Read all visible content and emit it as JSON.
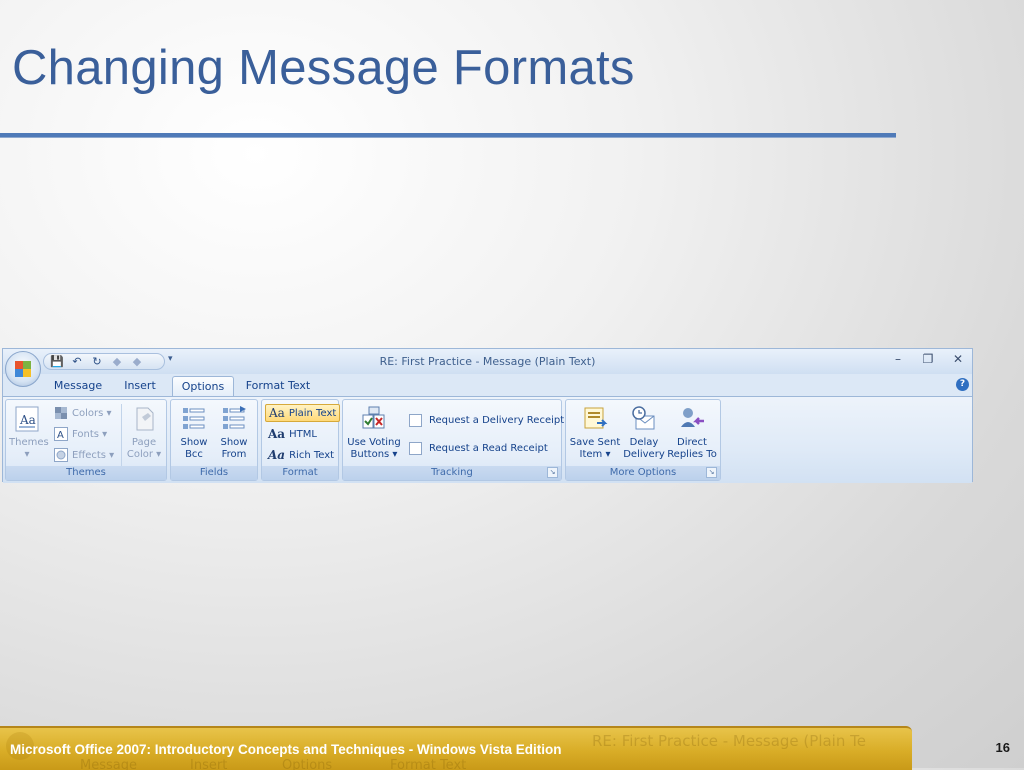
{
  "slide": {
    "title": "Changing Message Formats",
    "footer": "Microsoft Office 2007: Introductory Concepts and Techniques - Windows Vista Edition",
    "page_number": "16",
    "footer_ghost": {
      "message": "Message",
      "insert": "Insert",
      "options": "Options",
      "format_text": "Format Text",
      "title": "RE: First Practice  -  Message (Plain Te"
    }
  },
  "window": {
    "title": "RE: First Practice - Message (Plain Text)",
    "qat": {
      "save": "💾",
      "undo": "↶",
      "redo": "↻",
      "prev": "◆",
      "next": "◆",
      "more": "▾"
    },
    "controls": {
      "minimize": "–",
      "restore": "❐",
      "close": "✕"
    },
    "tabs": [
      {
        "label": "Message",
        "active": false
      },
      {
        "label": "Insert",
        "active": false
      },
      {
        "label": "Options",
        "active": true
      },
      {
        "label": "Format Text",
        "active": false
      }
    ],
    "help": "?"
  },
  "ribbon": {
    "themes": {
      "label": "Themes",
      "themes_btn": "Themes",
      "themes_arrow": "▾",
      "colors": "Colors ▾",
      "fonts": "Fonts ▾",
      "effects": "Effects ▾",
      "page_color_line1": "Page",
      "page_color_line2": "Color ▾"
    },
    "fields": {
      "label": "Fields",
      "show_bcc_1": "Show",
      "show_bcc_2": "Bcc",
      "show_from_1": "Show",
      "show_from_2": "From"
    },
    "format": {
      "label": "Format",
      "plain_text": "Plain Text",
      "html": "HTML",
      "rich_text": "Rich Text",
      "aa": "Aa",
      "selected": "Plain Text"
    },
    "tracking": {
      "label": "Tracking",
      "voting_1": "Use Voting",
      "voting_2": "Buttons ▾",
      "delivery_receipt": "Request a Delivery Receipt",
      "read_receipt": "Request a Read Receipt",
      "launcher": "↘"
    },
    "more_options": {
      "label": "More Options",
      "save_sent_1": "Save Sent",
      "save_sent_2": "Item ▾",
      "delay_1": "Delay",
      "delay_2": "Delivery",
      "direct_1": "Direct",
      "direct_2": "Replies To",
      "launcher": "↘"
    }
  },
  "colors": {
    "title": "#3a5f9a",
    "rule": "#4f7ab8",
    "footer": "#d9ad27",
    "ribbon_text": "#15428b"
  }
}
